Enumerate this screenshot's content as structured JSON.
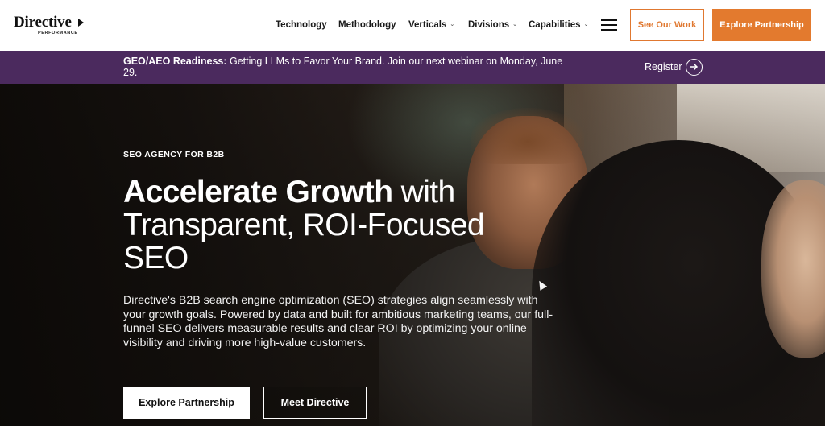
{
  "header": {
    "logo": {
      "main": "Directive",
      "sub": "PERFORMANCE"
    },
    "nav": [
      {
        "label": "Technology",
        "has_dropdown": false
      },
      {
        "label": "Methodology",
        "has_dropdown": false
      },
      {
        "label": "Verticals",
        "has_dropdown": true
      },
      {
        "label": "Divisions",
        "has_dropdown": true
      },
      {
        "label": "Capabilities",
        "has_dropdown": true
      }
    ],
    "menu_icon": "hamburger-icon",
    "see_work_label": "See Our Work",
    "explore_label": "Explore Partnership"
  },
  "banner": {
    "bold": "GEO/AEO Readiness:",
    "text": " Getting LLMs to Favor Your Brand. Join our next webinar on Monday, June 29.",
    "register_label": "Register",
    "register_icon": "arrow-right-circle-icon"
  },
  "hero": {
    "eyebrow": "SEO AGENCY FOR B2B",
    "headline_bold": "Accelerate Growth",
    "headline_rest": " with Transparent, ROI-Focused SEO",
    "description": "Directive's B2B search engine optimization (SEO) strategies align seamlessly with your growth goals. Powered by data and built for ambitious marketing teams, our full-funnel SEO delivers measurable results and clear ROI by optimizing your online visibility and driving more high-value customers.",
    "primary_cta": "Explore Partnership",
    "secondary_cta": "Meet Directive"
  },
  "colors": {
    "accent_orange": "#e37a2e",
    "banner_purple": "#4b2a5e"
  }
}
